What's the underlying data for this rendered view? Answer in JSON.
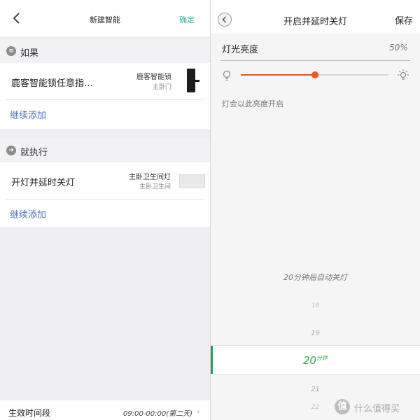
{
  "left": {
    "header": {
      "title": "新建智能",
      "confirm": "确定"
    },
    "if_section": {
      "label": "如果",
      "icon": "list-icon"
    },
    "trigger": {
      "title": "鹿客智能锁任意指…",
      "device": "鹿客智能锁",
      "room": "主卧门"
    },
    "add_more_1": "继续添加",
    "then_section": {
      "label": "就执行",
      "icon": "arrow-right-icon"
    },
    "action": {
      "title": "开灯并延时关灯",
      "device": "主卧卫生间灯",
      "room": "主卧卫生间"
    },
    "add_more_2": "继续添加",
    "effective_time": {
      "label": "生效时间段",
      "value": "09:00-00:00(第二天)"
    }
  },
  "right": {
    "header": {
      "title": "开启并延时关灯",
      "save": "保存"
    },
    "brightness": {
      "label": "灯光亮度",
      "value_text": "50%",
      "level": 0.5
    },
    "accent_color": "#e45a2b",
    "hint": "灯会以此亮度开启",
    "auto_off": "20分钟后自动关灯",
    "picker": {
      "items": [
        "18",
        "19",
        "21",
        "22"
      ],
      "selected": "20",
      "selected_suffix": "分钟",
      "selected_color": "#33aa44"
    },
    "watermark": {
      "logo": "值",
      "text": "什么值得买"
    }
  }
}
